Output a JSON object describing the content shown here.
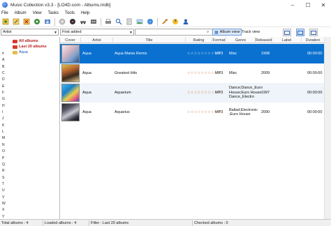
{
  "window": {
    "title": "Music Collection v3.3 - [LO4D.com - Albums.mdb]",
    "controls": [
      "–",
      "☐",
      "✕"
    ]
  },
  "menu": [
    "File",
    "Album",
    "View",
    "Tasks",
    "Tools",
    "Help"
  ],
  "toolbar": {
    "icons": [
      "new-album-icon",
      "edit-icon",
      "delete-icon",
      "scan-icon",
      "import-icon",
      "cd-icon",
      "disc-icon",
      "car-icon",
      "tape-icon",
      "print-icon",
      "zoom-icon",
      "report-icon",
      "image-icon",
      "internet-icon",
      "settings-icon",
      "help-icon",
      "user-icon"
    ]
  },
  "filter": {
    "field_select": "Artist",
    "sort_select": "First added",
    "search_value": "",
    "album_view_label": "Album view",
    "track_view_label": "Track view"
  },
  "sidebar": {
    "tree": [
      {
        "label": "All albums"
      },
      {
        "label": "Last 20 albums"
      },
      {
        "label": "Aqua"
      }
    ],
    "alphabet": [
      "#",
      "A",
      "B",
      "C",
      "D",
      "E",
      "F",
      "G",
      "H",
      "I",
      "J",
      "K",
      "L",
      "M",
      "N",
      "O",
      "P",
      "Q",
      "R",
      "S",
      "T",
      "U",
      "V",
      "W",
      "X",
      "Y",
      "Z"
    ]
  },
  "table": {
    "columns": [
      "Cover",
      "Artist",
      "Title",
      "Rating",
      "Format",
      "Genre",
      "Released",
      "Label",
      "Duration"
    ],
    "rows": [
      {
        "artist": "Aqua",
        "title": "Aqua Mania Remix",
        "rating": "☆☆☆☆☆☆☆☆☆☆",
        "format": "MP3",
        "genre": "Misc",
        "released": "1998",
        "label": "",
        "duration": "00:00:00"
      },
      {
        "artist": "Aqua",
        "title": "Greatest Hits",
        "rating": "☆☆☆☆☆☆☆☆☆☆",
        "format": "MP3",
        "genre": "Misc",
        "released": "2009",
        "label": "",
        "duration": "00:00:00"
      },
      {
        "artist": "Aqua",
        "title": "Aquarium",
        "rating": "☆☆☆☆☆☆☆☆☆☆",
        "format": "MP3",
        "genre": "Dance;Dance_Euro\n House;Euro House\n Dance_Electro",
        "released": "1997",
        "label": "",
        "duration": "00:00:00"
      },
      {
        "artist": "Aqua",
        "title": "Aquarius",
        "rating": "☆☆☆☆☆☆☆☆☆☆",
        "format": "MP3",
        "genre": "Ballad;Electronic\n;Euro House",
        "released": "2000",
        "label": "",
        "duration": "00:00:00"
      }
    ]
  },
  "status": {
    "total": "Total albums : 4",
    "loaded": "Loaded albums : 4",
    "filter": "Filter : Last 20 albums",
    "checked": "Checked albums : 0"
  },
  "colors": {
    "selection": "#0a71d0",
    "alt_row": "#eef4f9",
    "star": "#c85a1e"
  }
}
